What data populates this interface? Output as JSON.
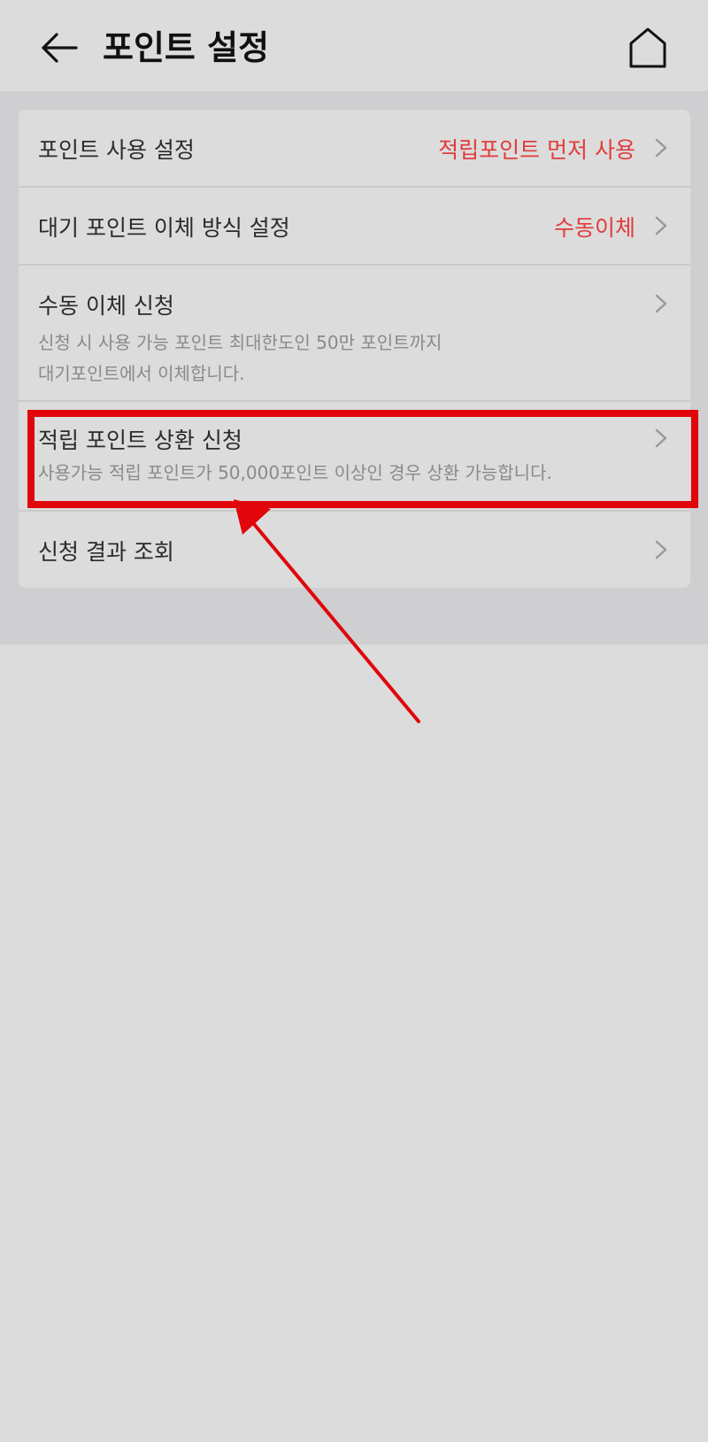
{
  "header": {
    "title": "포인트 설정",
    "back_icon": "arrow-left-icon",
    "home_icon": "home-icon"
  },
  "settings": {
    "items": [
      {
        "title": "포인트 사용 설정",
        "value": "적립포인트 먼저 사용"
      },
      {
        "title": "대기 포인트 이체 방식 설정",
        "value": "수동이체"
      },
      {
        "title": "수동 이체 신청",
        "desc_line1": "신청 시 사용 가능 포인트 최대한도인 50만 포인트까지",
        "desc_line2": "대기포인트에서 이체합니다."
      },
      {
        "title": "적립 포인트 상환 신청",
        "desc_line1": "사용가능 적립 포인트가 50,000포인트 이상인 경우 상환 가능합니다."
      },
      {
        "title": "신청 결과 조회"
      }
    ]
  },
  "colors": {
    "accent": "#e23b3b",
    "annotation": "#e0060b",
    "background": "#dcdcdc",
    "section_bg": "#cfcfd2"
  }
}
